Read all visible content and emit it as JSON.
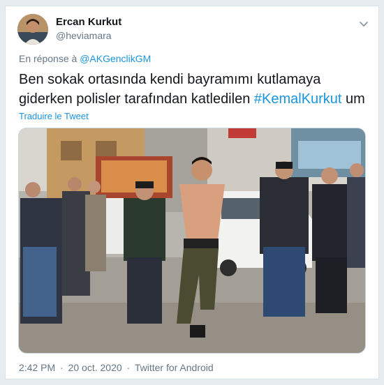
{
  "author": {
    "name": "Ercan Kurkut",
    "handle": "@heviamara"
  },
  "reply_context": {
    "prefix": "En réponse à",
    "mention": "@AKGenclikGM"
  },
  "tweet": {
    "text_before": "Ben sokak ortasında kendi bayramımı kutlamaya giderken polisler tarafından katledilen ",
    "hashtag": "#KemalKurkut",
    "text_after": " um",
    "translate_label": "Traduire le Tweet"
  },
  "meta": {
    "time": "2:42 PM",
    "separator": "·",
    "date": "20 oct. 2020",
    "source": "Twitter for Android"
  },
  "icons": {
    "menu": "chevron-down-icon"
  },
  "colors": {
    "link": "#1b95e0",
    "muted": "#657786",
    "text": "#14171a"
  }
}
